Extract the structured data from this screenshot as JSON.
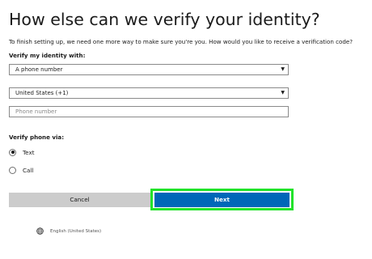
{
  "title": "How else can we verify your identity?",
  "description": "To finish setting up, we need one more way to make sure you're you. How would you like to receive a verification code?",
  "verify_identity_label": "Verify my identity with:",
  "identity_method_select": {
    "value": "A phone number"
  },
  "country_select": {
    "value": "United States (+1)"
  },
  "phone_input": {
    "placeholder": "Phone number",
    "value": ""
  },
  "verify_phone_label": "Verify phone via:",
  "phone_methods": [
    {
      "label": "Text",
      "checked": true
    },
    {
      "label": "Call",
      "checked": false
    }
  ],
  "buttons": {
    "cancel": "Cancel",
    "next": "Next"
  },
  "footer": {
    "language": "English (United States)"
  },
  "colors": {
    "primary": "#0067b8",
    "highlight": "#22e32a",
    "secondary_button": "#cccccc"
  },
  "icons": {
    "dropdown": "caret-down-icon",
    "language": "globe-icon"
  }
}
